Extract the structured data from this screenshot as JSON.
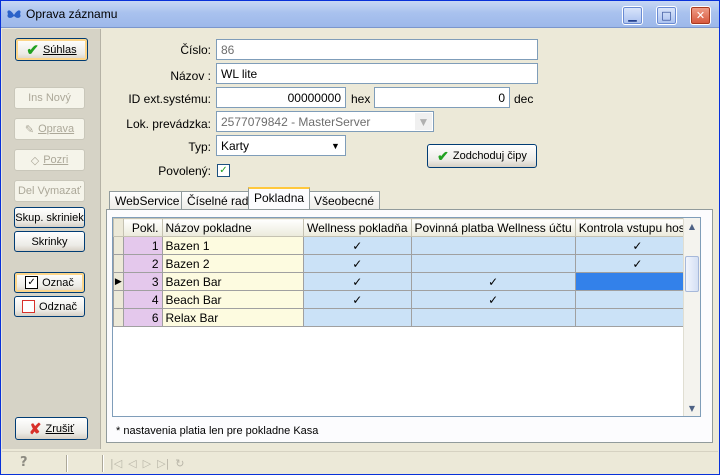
{
  "window": {
    "title": "Oprava záznamu"
  },
  "sidebar": {
    "suhlas": "Súhlas",
    "ins_novy": "Ins Nový",
    "oprava": "Oprava",
    "pozri": "Pozri",
    "del_vymazat": "Del Vymazať",
    "skup_skriniek": "Skup. skriniek",
    "skrinky": "Skrinky",
    "oznac": "Označ",
    "odznac": "Odznač",
    "zrusit": "Zrušiť"
  },
  "form": {
    "cislo_label": "Číslo:",
    "cislo_value": "86",
    "nazov_label": "Názov :",
    "nazov_value": "WL lite",
    "idext_label": "ID ext.systému:",
    "hex_value": "00000000",
    "hex_label": "hex",
    "dec_value": "0",
    "dec_label": "dec",
    "lok_label": "Lok. prevádzka:",
    "lok_value": "2577079842 - MasterServer",
    "typ_label": "Typ:",
    "typ_value": "Karty",
    "povoleny_label": "Povolený:",
    "povoleny_checked": true,
    "zodchoduj_button": "Zodchoduj čipy"
  },
  "tabs": [
    {
      "label": "WebService",
      "active": false
    },
    {
      "label": "Číselné rady",
      "active": false
    },
    {
      "label": "Pokladna",
      "active": true
    },
    {
      "label": "Všeobecné",
      "active": false
    }
  ],
  "grid": {
    "columns": [
      "Pokl.",
      "Názov pokladne",
      "Wellness pokladňa",
      "Povinná platba Wellness účtu",
      "Kontrola vstupu hosťa"
    ],
    "rows": [
      {
        "pokl": "1",
        "nazov": "Bazen 1",
        "wellness": "✓",
        "povinna": "",
        "kontrola": "✓",
        "current": false
      },
      {
        "pokl": "2",
        "nazov": "Bazen 2",
        "wellness": "✓",
        "povinna": "",
        "kontrola": "✓",
        "current": false
      },
      {
        "pokl": "3",
        "nazov": "Bazen Bar",
        "wellness": "✓",
        "povinna": "✓",
        "kontrola": "",
        "current": true
      },
      {
        "pokl": "4",
        "nazov": "Beach Bar",
        "wellness": "✓",
        "povinna": "✓",
        "kontrola": "",
        "current": false
      },
      {
        "pokl": "6",
        "nazov": "Relax Bar",
        "wellness": "",
        "povinna": "",
        "kontrola": "",
        "current": false
      }
    ]
  },
  "note": "* nastavenia platia len pre pokladne Kasa",
  "colors": {
    "accent": "#3381ea",
    "check_green": "#21a121",
    "cancel_red": "#d8302a"
  }
}
